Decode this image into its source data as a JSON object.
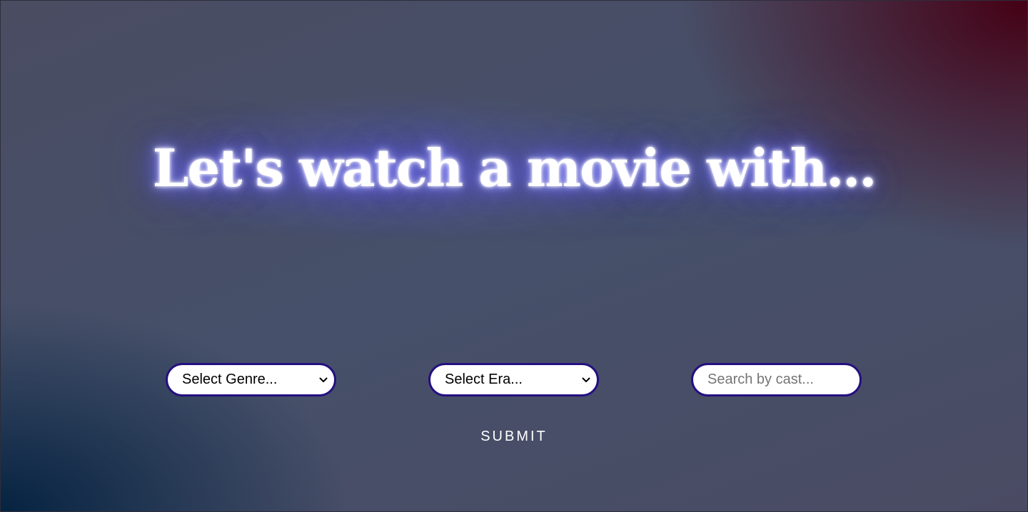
{
  "hero": {
    "title": "Let's watch a movie with..."
  },
  "filters": {
    "genre": {
      "selected": "Select Genre...",
      "icon": "chevron-down-icon"
    },
    "era": {
      "selected": "Select Era...",
      "icon": "chevron-down-icon"
    },
    "cast": {
      "value": "",
      "placeholder": "Search by cast..."
    }
  },
  "actions": {
    "submit_label": "SUBMIT"
  },
  "colors": {
    "field_border": "#241080",
    "glow": "#5a55e6",
    "background_dark_red": "#460014",
    "background_dark_blue": "#052341"
  }
}
